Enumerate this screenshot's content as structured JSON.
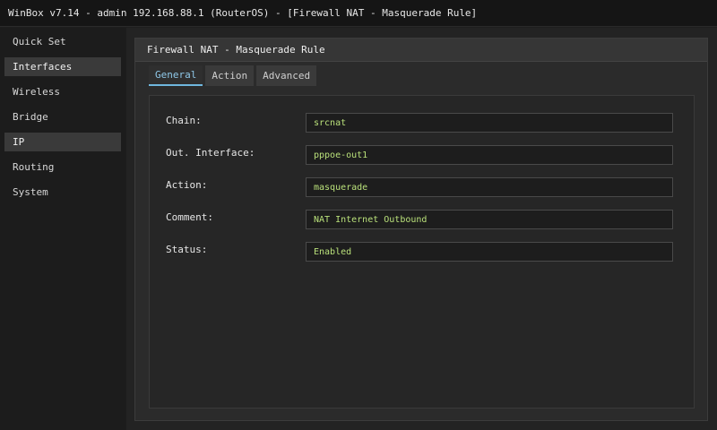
{
  "window_title": "WinBox v7.14 - admin 192.168.88.1 (RouterOS) - [Firewall NAT - Masquerade Rule]",
  "sidebar": {
    "items": [
      {
        "label": "Quick Set",
        "active": false
      },
      {
        "label": "Interfaces",
        "active": true
      },
      {
        "label": "Wireless",
        "active": false
      },
      {
        "label": "Bridge",
        "active": false
      },
      {
        "label": "IP",
        "active": true
      },
      {
        "label": "Routing",
        "active": false
      },
      {
        "label": "System",
        "active": false
      }
    ]
  },
  "dialog": {
    "title": "Firewall NAT - Masquerade Rule",
    "tabs": [
      {
        "label": "General",
        "active": true
      },
      {
        "label": "Action",
        "active": false
      },
      {
        "label": "Advanced",
        "active": false
      }
    ],
    "fields": [
      {
        "label": "Chain:",
        "value": "srcnat"
      },
      {
        "label": "Out. Interface:",
        "value": "pppoe-out1"
      },
      {
        "label": "Action:",
        "value": "masquerade"
      },
      {
        "label": "Comment:",
        "value": "NAT Internet Outbound"
      },
      {
        "label": "Status:",
        "value": "Enabled"
      }
    ]
  },
  "colors": {
    "background": "#1e1e1e",
    "field_value": "#b9e07a",
    "active_tab": "#8fc8e8"
  }
}
